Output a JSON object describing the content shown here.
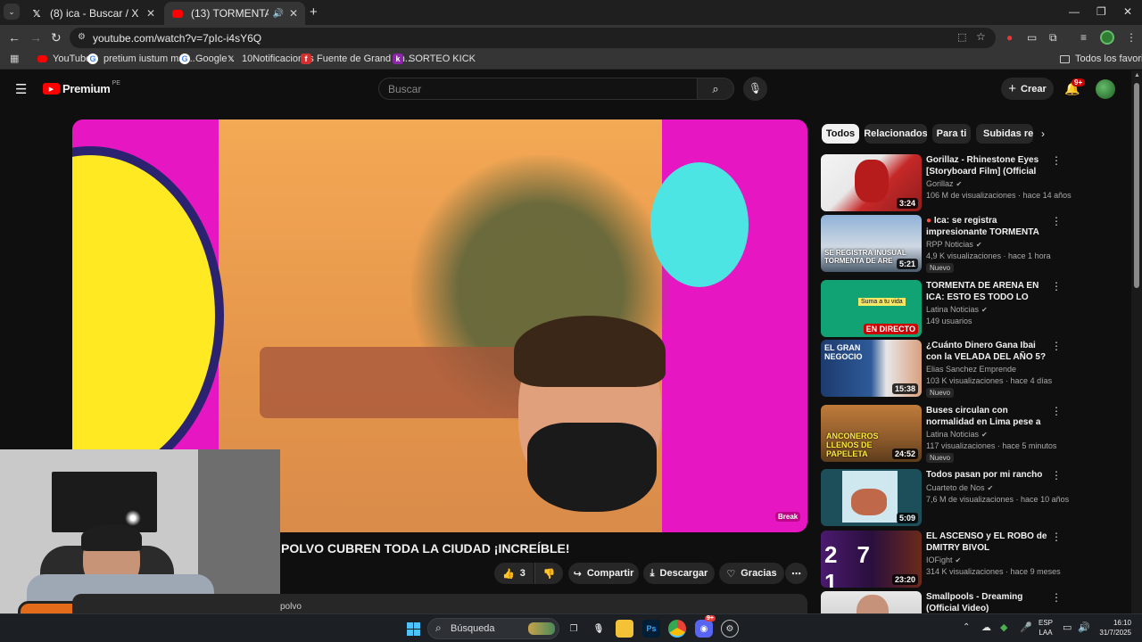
{
  "browser": {
    "tabs": [
      {
        "title": "(8) ica - Buscar / X",
        "favicon": "x-logo-icon",
        "active": false
      },
      {
        "title": "(13) TORMENTA DE ARENA",
        "favicon": "youtube-icon",
        "active": true
      }
    ],
    "new_tab_symbol": "+",
    "url": "youtube.com/watch?v=7pIc-i4sY6Q",
    "bookmarks": [
      {
        "label": "YouTube",
        "icon": "youtube-icon"
      },
      {
        "label": "pretium iustum mat...",
        "icon": "google-icon"
      },
      {
        "label": "Google",
        "icon": "google-icon"
      },
      {
        "label": "10Notificaciones",
        "icon": "x-logo-icon"
      },
      {
        "label": "Fuente de Grand Th...",
        "icon": "flash-icon"
      },
      {
        "label": "SORTEO KICK",
        "icon": "kick-icon"
      }
    ],
    "bookmarks_folder": "Todos los favoritos"
  },
  "youtube": {
    "logo": "Premium",
    "region": "PE",
    "search_placeholder": "Buscar",
    "create_label": "Crear",
    "notif_count": "9+",
    "video": {
      "title_visible": "POLVO CUBREN TODA LA CIUDAD ¡INCREÍBLE!",
      "likes": "3",
      "share_label": "Compartir",
      "download_label": "Descargar",
      "thanks_label": "Gracias",
      "description_snippet": "polvo",
      "watermark": "Break"
    },
    "chips": [
      "Todos",
      "Relacionados",
      "Para ti",
      "Subidas reci"
    ],
    "recommendations": [
      {
        "title": "Gorillaz - Rhinestone Eyes [Storyboard Film] (Official Mus...",
        "channel": "Gorillaz",
        "verified": true,
        "meta": "106 M de visualizaciones · hace 14 años",
        "duration": "3:24",
        "badge": ""
      },
      {
        "title": "Ica: se registra impresionante TORMENTA DE ...",
        "channel": "RPP Noticias",
        "verified": true,
        "meta": "4,9 K visualizaciones · hace 1 hora",
        "duration": "5:21",
        "badge": "Nuevo"
      },
      {
        "title": "TORMENTA DE ARENA EN ICA: ESTO ES TODO LO QUE SE ...",
        "channel": "Latina Noticias",
        "verified": true,
        "meta": "149 usuarios",
        "duration": "EN DIRECTO",
        "badge": ""
      },
      {
        "title": "¿Cuánto Dinero Gana Ibai con la VELADA DEL AÑO 5?",
        "channel": "Elias Sanchez Emprende",
        "verified": false,
        "meta": "103 K visualizaciones · hace 4 días",
        "duration": "15:38",
        "badge": "Nuevo"
      },
      {
        "title": "Buses circulan con normalidad en Lima pese a multas: \"Esta ...",
        "channel": "Latina Noticias",
        "verified": true,
        "meta": "117 visualizaciones · hace 5 minutos",
        "duration": "24:52",
        "badge": "Nuevo"
      },
      {
        "title": "Todos pasan por mi rancho",
        "channel": "Cuarteto de Nos",
        "verified": true,
        "meta": "7,6 M de visualizaciones · hace 10 años",
        "duration": "5:09",
        "badge": ""
      },
      {
        "title": "EL ASCENSO y EL ROBO de DMITRY BIVOL",
        "channel": "IOFight",
        "verified": true,
        "meta": "314 K visualizaciones · hace 9 meses",
        "duration": "23:20",
        "badge": ""
      },
      {
        "title": "Smallpools - Dreaming (Official Video)",
        "channel": "",
        "verified": false,
        "meta": "",
        "duration": "",
        "badge": ""
      }
    ],
    "thumb_texts": {
      "rec2": "SE REGISTRA INUSUAL TORMENTA DE ARE",
      "rec3_top": "Suma a tu vida",
      "rec4": "EL GRAN NEGOCIO",
      "rec5": "ANCONEROS LLENOS DE PAPELETA",
      "rec7": "27 1"
    }
  },
  "taskbar": {
    "search_label": "Búsqueda",
    "language": "ESP",
    "layout": "LAA",
    "time": "16:10",
    "date": "31/7/2025",
    "badge_count": "9+"
  },
  "colors": {
    "yt_red": "#ff0000",
    "video_magenta": "#e617c2",
    "video_orange": "#f2a24b",
    "accent_blue": "#3ea6ff"
  }
}
